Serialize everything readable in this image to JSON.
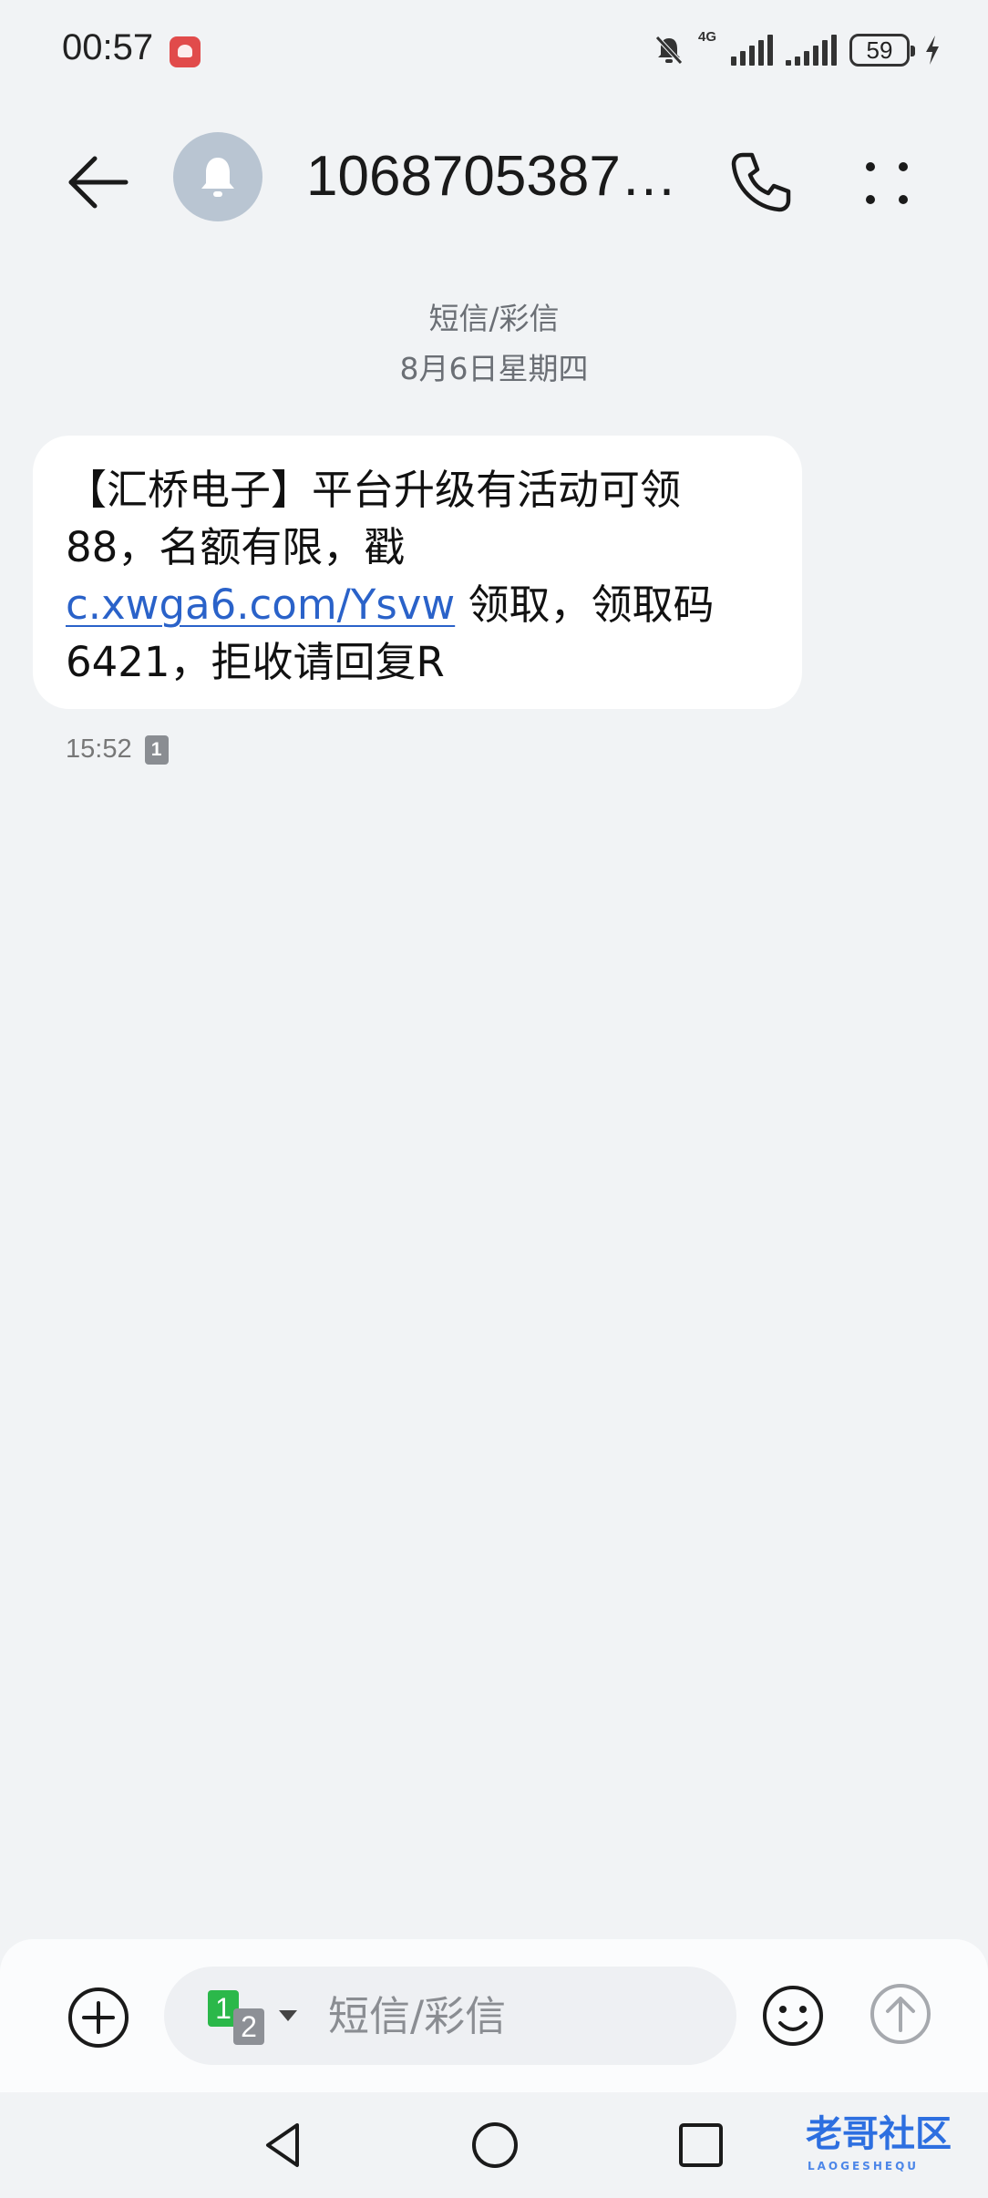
{
  "status_bar": {
    "time": "00:57",
    "network_label": "4G",
    "battery": "59"
  },
  "header": {
    "title": "1068705387…",
    "icons": [
      "back-arrow-icon",
      "notification-bell-icon",
      "phone-icon",
      "more-icon"
    ]
  },
  "conversation": {
    "type_label": "短信/彩信",
    "date_label": "8月6日星期四"
  },
  "message": {
    "text_before_link": "【汇桥电子】平台升级有活动可领88，名额有限，戳 ",
    "link_text": "c.xwga6.com/Ysvw",
    "text_after_link": " 领取，领取码6421，拒收请回复R",
    "time": "15:52",
    "sim_slot": "1"
  },
  "composer": {
    "placeholder": "短信/彩信",
    "sim_primary": "1",
    "sim_secondary": "2"
  },
  "watermark": {
    "text": "老哥社区",
    "subtext": "LAOGESHEQU"
  },
  "colors": {
    "background": "#f1f3f5",
    "link": "#2a62c9",
    "sim_green": "#2bb84a"
  }
}
